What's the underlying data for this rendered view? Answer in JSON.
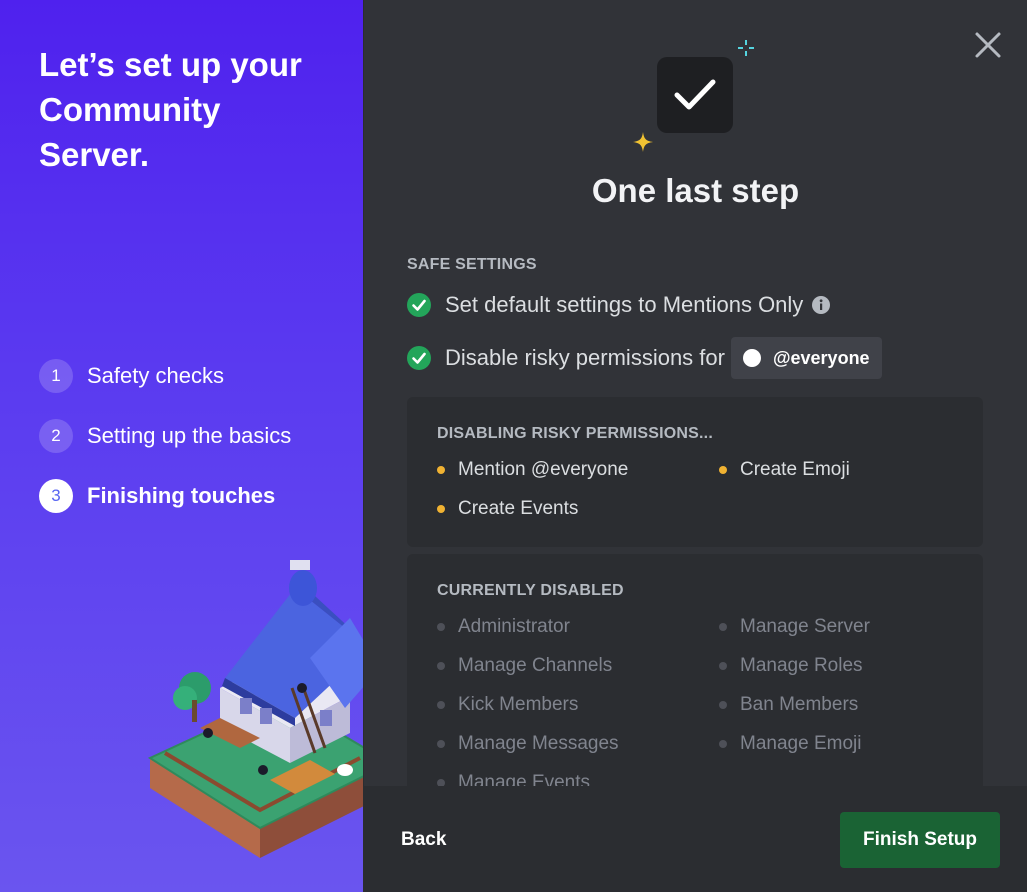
{
  "sidebar": {
    "title": "Let’s set up your Community Server.",
    "steps": [
      {
        "num": "1",
        "label": "Safety checks"
      },
      {
        "num": "2",
        "label": "Setting up the basics"
      },
      {
        "num": "3",
        "label": "Finishing touches"
      }
    ]
  },
  "main": {
    "title": "One last step",
    "safe_settings": {
      "header": "SAFE SETTINGS",
      "item1": "Set default settings to Mentions Only",
      "item2": "Disable risky permissions for",
      "role": "@everyone"
    },
    "disabling": {
      "header": "DISABLING RISKY PERMISSIONS...",
      "items": [
        "Mention @everyone",
        "Create Emoji",
        "Create Events"
      ]
    },
    "disabled": {
      "header": "CURRENTLY DISABLED",
      "items": [
        "Administrator",
        "Manage Server",
        "Manage Channels",
        "Manage Roles",
        "Kick Members",
        "Ban Members",
        "Manage Messages",
        "Manage Emoji",
        "Manage Events"
      ]
    }
  },
  "footer": {
    "back_label": "Back",
    "finish_label": "Finish Setup"
  },
  "colors": {
    "accent": "#5865f2",
    "success": "#23a55a",
    "warning": "#f0b232",
    "finish_button": "#1a6334"
  },
  "icons": {
    "close": "close-icon",
    "check": "checkmark-icon",
    "info": "info-icon",
    "success": "check-circle-icon"
  }
}
